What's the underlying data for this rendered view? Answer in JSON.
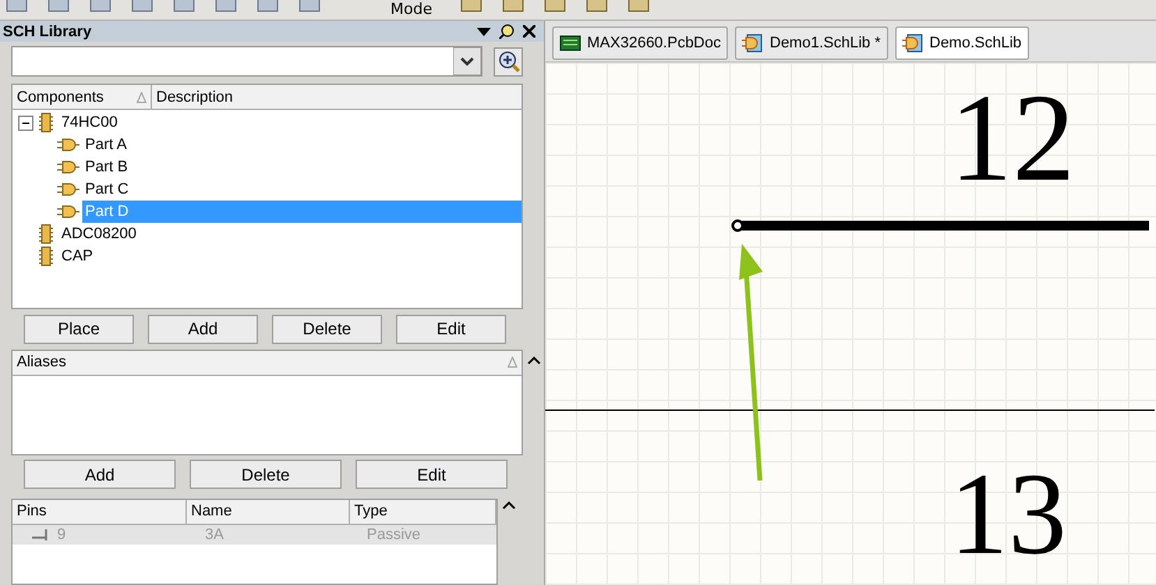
{
  "toolbar": {
    "mode_label": "Mode"
  },
  "panel": {
    "title": "SCH Library",
    "components": {
      "columns": [
        "Components",
        "Description"
      ],
      "items": [
        {
          "label": "74HC00",
          "expanded": true,
          "selected": false,
          "children": [
            {
              "label": "Part A",
              "selected": false
            },
            {
              "label": "Part B",
              "selected": false
            },
            {
              "label": "Part C",
              "selected": false
            },
            {
              "label": "Part D",
              "selected": true
            }
          ]
        },
        {
          "label": "ADC08200",
          "selected": false
        },
        {
          "label": "CAP",
          "selected": false
        }
      ]
    },
    "component_buttons": [
      "Place",
      "Add",
      "Delete",
      "Edit"
    ],
    "aliases": {
      "columns": [
        "Aliases"
      ]
    },
    "alias_buttons": [
      "Add",
      "Delete",
      "Edit"
    ],
    "pins": {
      "columns": [
        "Pins",
        "Name",
        "Type"
      ],
      "rows": [
        {
          "pin": "9",
          "name": "3A",
          "type": "Passive"
        }
      ]
    }
  },
  "tabs": [
    {
      "label": "MAX32660.PcbDoc",
      "kind": "pcb",
      "selected": false
    },
    {
      "label": "Demo1.SchLib *",
      "kind": "schlib",
      "selected": false
    },
    {
      "label": "Demo.SchLib",
      "kind": "schlib",
      "selected": true
    }
  ],
  "canvas": {
    "pin_numbers": [
      "12",
      "13"
    ]
  }
}
